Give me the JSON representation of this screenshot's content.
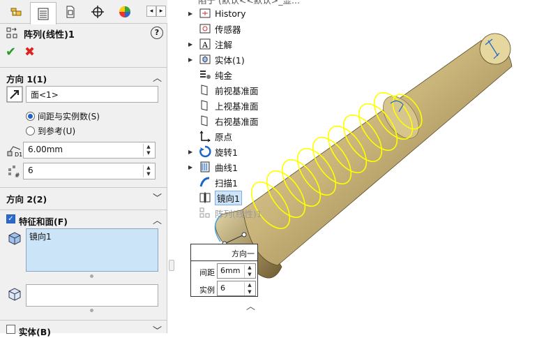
{
  "property_manager": {
    "tabs": [
      {
        "icon": "feature-manager-icon"
      },
      {
        "icon": "property-manager-icon",
        "active": true
      },
      {
        "icon": "configuration-manager-icon"
      },
      {
        "icon": "dimxpert-icon"
      },
      {
        "icon": "display-manager-icon"
      }
    ],
    "scroll_left": "◂",
    "scroll_right": "▸",
    "title": "阵列(线性)1",
    "help": "?",
    "ok": "✔",
    "cancel": "✖",
    "direction1": {
      "label": "方向 1(1)",
      "chevron": "︿",
      "edge_value": "面<1>",
      "radio_spacing": "间距与实例数(S)",
      "radio_reference": "到参考(U)",
      "spacing_value": "6.00mm",
      "count_value": "6"
    },
    "direction2": {
      "label": "方向 2(2)",
      "chevron": "﹀"
    },
    "features": {
      "label": "特征和面(F)",
      "chevron": "︿",
      "checked": true,
      "list_items": [
        "镜向1"
      ]
    },
    "bodies": {
      "label": "实体(B)",
      "chevron": "﹀",
      "checked": false
    },
    "spin_up": "▲",
    "spin_down": "▼"
  },
  "feature_tree": {
    "top_partial": "陷于 (默认<<默认>_显...",
    "items": [
      {
        "label": "History",
        "icon": "history-icon",
        "expandable": true
      },
      {
        "label": "传感器",
        "icon": "sensor-icon",
        "expandable": false
      },
      {
        "label": "注解",
        "icon": "annotation-icon",
        "expandable": true
      },
      {
        "label": "实体(1)",
        "icon": "solid-bodies-icon",
        "expandable": true
      },
      {
        "label": "纯金",
        "icon": "material-icon",
        "expandable": false
      },
      {
        "label": "前视基准面",
        "icon": "plane-icon",
        "expandable": false
      },
      {
        "label": "上视基准面",
        "icon": "plane-icon",
        "expandable": false
      },
      {
        "label": "右视基准面",
        "icon": "plane-icon",
        "expandable": false
      },
      {
        "label": "原点",
        "icon": "origin-icon",
        "expandable": false
      },
      {
        "label": "旋转1",
        "icon": "revolve-icon",
        "expandable": true
      },
      {
        "label": "曲线1",
        "icon": "curve-icon",
        "expandable": true
      },
      {
        "label": "扫描1",
        "icon": "sweep-icon",
        "expandable": false
      },
      {
        "label": "镜向1",
        "icon": "mirror-icon",
        "expandable": false,
        "selected": true
      },
      {
        "label": "阵列(线性)1",
        "icon": "linear-pattern-icon",
        "expandable": false,
        "greyed": true
      }
    ],
    "expander": "▶"
  },
  "callout": {
    "header": "方向一",
    "spacing_label": "间距",
    "spacing_value": "6mm",
    "count_label": "实例",
    "count_value": "6",
    "collapse": "︿"
  },
  "colors": {
    "part_body": "#c9b47a",
    "highlight": "#ffff00",
    "selection": "#cde3f7",
    "accent": "#1e63c9"
  }
}
